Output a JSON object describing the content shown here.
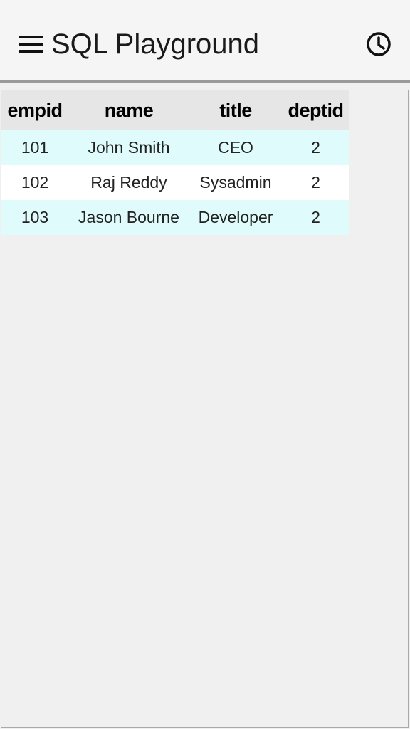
{
  "app": {
    "title": "SQL Playground",
    "menu_icon": "hamburger-menu-icon",
    "history_icon": "clock-history-icon"
  },
  "results": {
    "columns": [
      "empid",
      "name",
      "title",
      "deptid"
    ],
    "rows": [
      [
        "101",
        "John Smith",
        "CEO",
        "2"
      ],
      [
        "102",
        "Raj Reddy",
        "Sysadmin",
        "2"
      ],
      [
        "103",
        "Jason Bourne",
        "Developer",
        "2"
      ]
    ]
  },
  "colors": {
    "odd_row": "#e0fbfc",
    "even_row": "#ffffff",
    "header_row": "#e6e6e6",
    "background": "#f0f0f0"
  }
}
